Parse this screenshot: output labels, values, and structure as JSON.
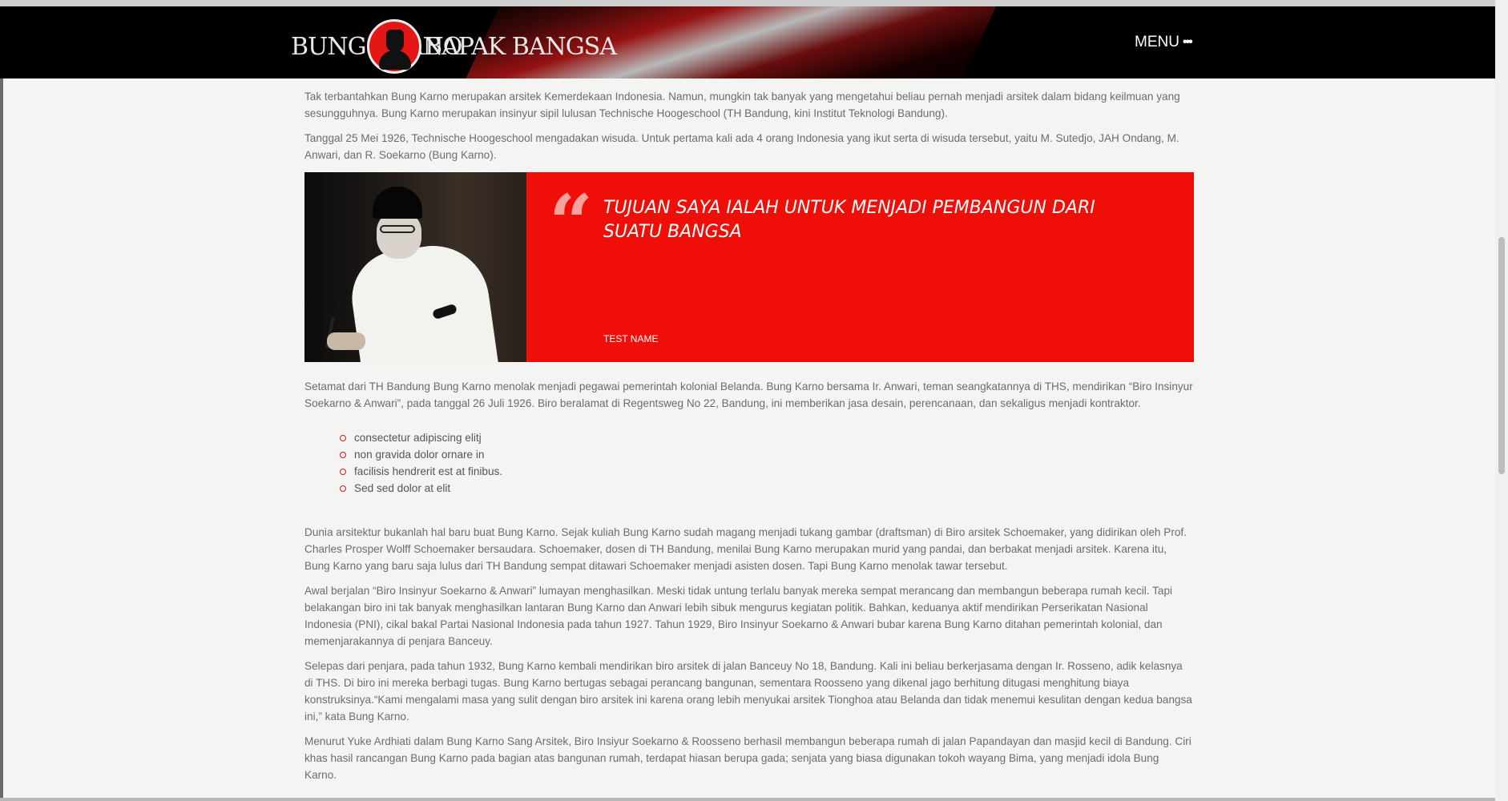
{
  "header": {
    "logo_left": "BUNG KARNO",
    "logo_right": "BAPAK BANGSA",
    "menu_label": "MENU",
    "menu_dots": "•••"
  },
  "article": {
    "paragraphs_top": [
      "Tak terbantahkan Bung Karno merupakan arsitek Kemerdekaan Indonesia. Namun, mungkin tak banyak yang mengetahui beliau pernah menjadi arsitek dalam bidang keilmuan yang sesungguhnya. Bung Karno merupakan insinyur sipil lulusan Technische Hoogeschool (TH Bandung, kini Institut Teknologi Bandung).",
      "Tanggal 25 Mei 1926, Technische Hoogeschool mengadakan wisuda. Untuk pertama kali ada 4 orang Indonesia yang ikut serta di wisuda tersebut, yaitu M. Sutedjo, JAH Ondang, M. Anwari, dan R. Soekarno (Bung Karno)."
    ],
    "quote": {
      "mark": "“",
      "text": "TUJUAN SAYA IALAH UNTUK MENJADI PEMBANGUN DARI SUATU BANGSA",
      "name": "TEST NAME"
    },
    "paragraph_middle": "Setamat dari TH Bandung Bung Karno menolak menjadi pegawai pemerintah kolonial Belanda. Bung Karno bersama Ir. Anwari, teman seangkatannya di THS, mendirikan “Biro Insinyur Soekarno & Anwari”, pada tanggal 26 Juli 1926. Biro beralamat di Regentsweg No 22, Bandung, ini memberikan jasa desain, perencanaan, dan sekaligus menjadi kontraktor.",
    "bullets": [
      "consectetur adipiscing elitj",
      "non gravida dolor ornare in",
      "facilisis hendrerit est at finibus.",
      "Sed sed dolor at elit"
    ],
    "paragraphs_bottom": [
      "Dunia arsitektur bukanlah hal baru buat Bung Karno. Sejak kuliah Bung Karno sudah magang menjadi tukang gambar (draftsman) di Biro arsitek Schoemaker, yang didirikan oleh Prof. Charles Prosper Wolff Schoemaker bersaudara. Schoemaker, dosen di TH Bandung, menilai Bung Karno merupakan murid yang pandai, dan berbakat menjadi arsitek. Karena itu, Bung Karno yang baru saja lulus dari TH Bandung sempat ditawari Schoemaker menjadi asisten dosen. Tapi Bung Karno menolak tawar tersebut.",
      "Awal berjalan “Biro Insinyur Soekarno & Anwari” lumayan menghasilkan. Meski tidak untung terlalu banyak mereka sempat merancang dan membangun beberapa rumah kecil. Tapi belakangan biro ini tak banyak menghasilkan lantaran Bung Karno dan Anwari lebih sibuk mengurus kegiatan politik. Bahkan, keduanya aktif mendirikan Perserikatan Nasional Indonesia (PNI), cikal bakal Partai Nasional Indonesia pada tahun 1927. Tahun 1929, Biro Insinyur Soekarno & Anwari bubar karena Bung Karno ditahan pemerintah kolonial, dan memenjarakannya di penjara Banceuy.",
      "Selepas dari penjara, pada tahun 1932, Bung Karno kembali mendirikan biro arsitek di jalan Banceuy No 18, Bandung. Kali ini beliau berkerjasama dengan Ir. Rosseno, adik kelasnya di THS. Di biro ini mereka berbagi tugas. Bung Karno bertugas sebagai perancang bangunan, sementara Roosseno yang dikenal jago berhitung ditugasi menghitung biaya konstruksinya.“Kami mengalami masa yang sulit dengan biro arsitek ini karena orang lebih menyukai arsitek Tionghoa atau Belanda dan tidak menemui kesulitan dengan kedua bangsa ini,” kata Bung Karno.",
      "Menurut Yuke Ardhiati dalam Bung Karno Sang Arsitek, Biro Insiyur Soekarno & Roosseno berhasil membangun beberapa rumah di jalan Papandayan dan masjid kecil di Bandung. Ciri khas hasil rancangan Bung Karno pada bagian atas bangunan rumah, terdapat hiasan berupa gada; senjata yang biasa digunakan tokoh wayang Bima, yang menjadi idola Bung Karno."
    ]
  },
  "colors": {
    "header_bg": "#000000",
    "accent_red": "#f00f08",
    "body_bg": "#f4f4f2",
    "text": "#6c6c6c"
  }
}
